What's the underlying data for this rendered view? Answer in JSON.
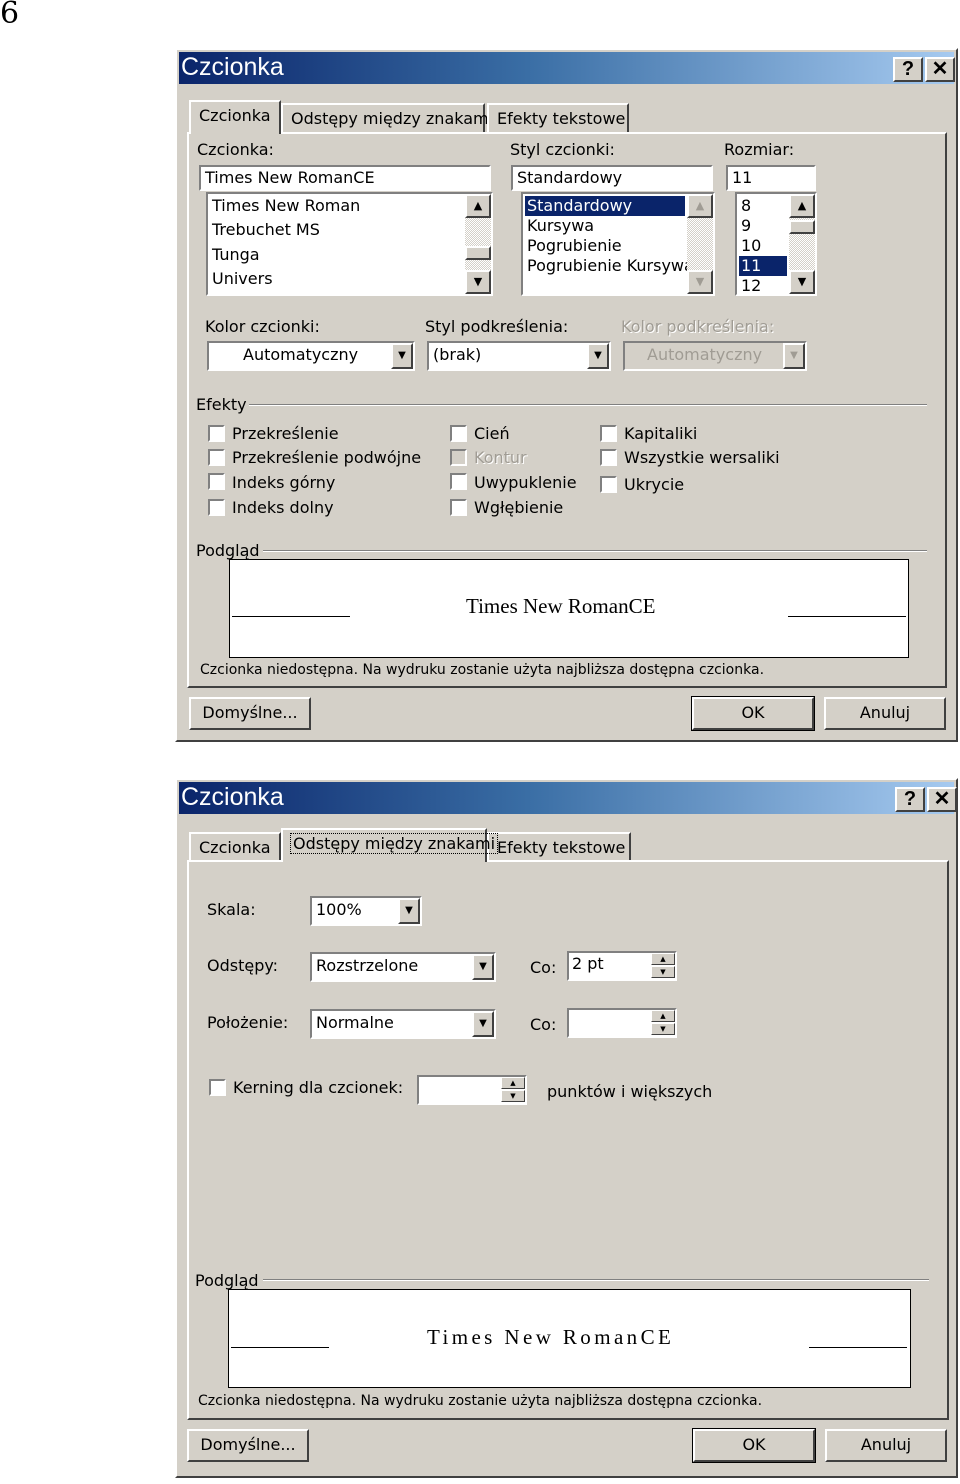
{
  "page_number": "6",
  "dialog1": {
    "title": "Czcionka",
    "help_label": "?",
    "close_label": "✕",
    "tabs": [
      {
        "label": "Czcionka",
        "active": true
      },
      {
        "label": "Odstępy między znakami",
        "active": false
      },
      {
        "label": "Efekty tekstowe",
        "active": false
      }
    ],
    "font": {
      "label": "Czcionka:",
      "value": "Times New RomanCE",
      "list": [
        "Times New Roman",
        "Trebuchet MS",
        "Tunga",
        "Univers"
      ]
    },
    "style": {
      "label": "Styl czcionki:",
      "value": "Standardowy",
      "list": [
        "Standardowy",
        "Kursywa",
        "Pogrubienie",
        "Pogrubienie Kursywa"
      ],
      "selected": "Standardowy"
    },
    "size": {
      "label": "Rozmiar:",
      "value": "11",
      "list": [
        "8",
        "9",
        "10",
        "11",
        "12"
      ],
      "selected": "11"
    },
    "font_color": {
      "label": "Kolor czcionki:",
      "value": "Automatyczny"
    },
    "underline_style": {
      "label": "Styl podkreślenia:",
      "value": "(brak)"
    },
    "underline_color": {
      "label": "Kolor podkreślenia:",
      "value": "Automatyczny",
      "disabled": true
    },
    "effects": {
      "label": "Efekty",
      "col1": [
        "Przekreślenie",
        "Przekreślenie podwójne",
        "Indeks górny",
        "Indeks dolny"
      ],
      "col2": [
        "Cień",
        "Kontur",
        "Uwypuklenie",
        "Wgłębienie"
      ],
      "col3": [
        "Kapitaliki",
        "Wszystkie wersaliki",
        "Ukrycie"
      ],
      "disabled": [
        "Kontur"
      ]
    },
    "preview": {
      "label": "Podgląd",
      "text": "Times New RomanCE",
      "note": "Czcionka niedostępna. Na wydruku zostanie użyta najbliższa dostępna czcionka."
    },
    "buttons": {
      "default_label": "Domyślne...",
      "ok_label": "OK",
      "cancel_label": "Anuluj"
    }
  },
  "dialog2": {
    "title": "Czcionka",
    "help_label": "?",
    "close_label": "✕",
    "tabs": [
      {
        "label": "Czcionka",
        "active": false
      },
      {
        "label": "Odstępy między znakami",
        "active": true
      },
      {
        "label": "Efekty tekstowe",
        "active": false
      }
    ],
    "scale": {
      "label": "Skala:",
      "value": "100%"
    },
    "spacing": {
      "label": "Odstępy:",
      "value": "Rozstrzelone",
      "by_label": "Co:",
      "by_value": "2 pt"
    },
    "position": {
      "label": "Położenie:",
      "value": "Normalne",
      "by_label": "Co:",
      "by_value": ""
    },
    "kerning": {
      "label": "Kerning dla czcionek:",
      "value": "",
      "suffix": "punktów i większych"
    },
    "preview": {
      "label": "Podgląd",
      "text": "Times New RomanCE",
      "note": "Czcionka niedostępna. Na wydruku zostanie użyta najbliższa dostępna czcionka."
    },
    "buttons": {
      "default_label": "Domyślne...",
      "ok_label": "OK",
      "cancel_label": "Anuluj"
    }
  }
}
